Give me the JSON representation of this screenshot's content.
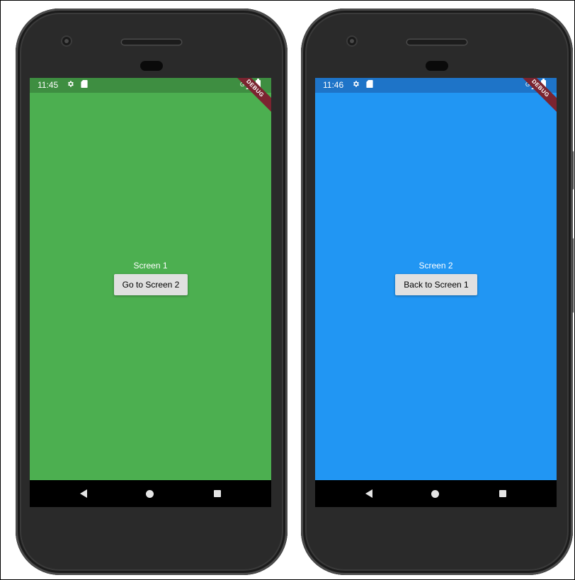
{
  "phones": [
    {
      "status": {
        "time": "11:45",
        "network": "G",
        "bar_color": "#3e8e41"
      },
      "app": {
        "background": "#4caf50",
        "label": "Screen 1",
        "button_label": "Go to Screen 2",
        "debug_banner": "DEBUG"
      }
    },
    {
      "status": {
        "time": "11:46",
        "network": "G",
        "bar_color": "#1e74c8"
      },
      "app": {
        "background": "#2196f3",
        "label": "Screen 2",
        "button_label": "Back to Screen 1",
        "debug_banner": "DEBUG"
      }
    }
  ],
  "icons": {
    "status": [
      "gear-icon",
      "sd-card-icon",
      "signal-icon",
      "battery-icon"
    ],
    "nav": [
      "back-icon",
      "home-icon",
      "recents-icon"
    ]
  }
}
